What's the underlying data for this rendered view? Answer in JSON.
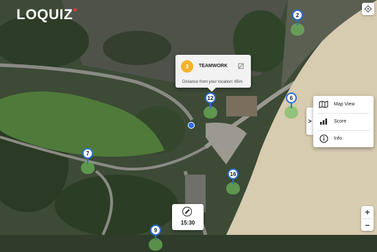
{
  "app": {
    "logo_text": "LOQUIZ"
  },
  "map": {
    "locate_icon": "crosshair-icon",
    "pins": [
      {
        "id": "pin-2",
        "number": "2"
      },
      {
        "id": "pin-12",
        "number": "12"
      },
      {
        "id": "pin-6",
        "number": "6"
      },
      {
        "id": "pin-7",
        "number": "7"
      },
      {
        "id": "pin-16",
        "number": "16"
      },
      {
        "id": "pin-9",
        "number": "9"
      }
    ]
  },
  "popup": {
    "badge_number": "3",
    "title": "TEAMWORK",
    "distance": "Distance from your location: 65m",
    "badge_color": "#f3b22b"
  },
  "side_menu": {
    "toggle_label": ">",
    "items": [
      {
        "label": "Map View",
        "icon": "map-icon"
      },
      {
        "label": "Score",
        "icon": "bar-chart-icon"
      },
      {
        "label": "Info",
        "icon": "info-icon"
      }
    ]
  },
  "timer": {
    "time": "15:30",
    "icon": "clock-icon"
  },
  "zoom": {
    "in_label": "+",
    "out_label": "−"
  },
  "colors": {
    "accent": "#2a6fd6",
    "pin_area": "#6ebe5a",
    "badge": "#f3b22b"
  }
}
